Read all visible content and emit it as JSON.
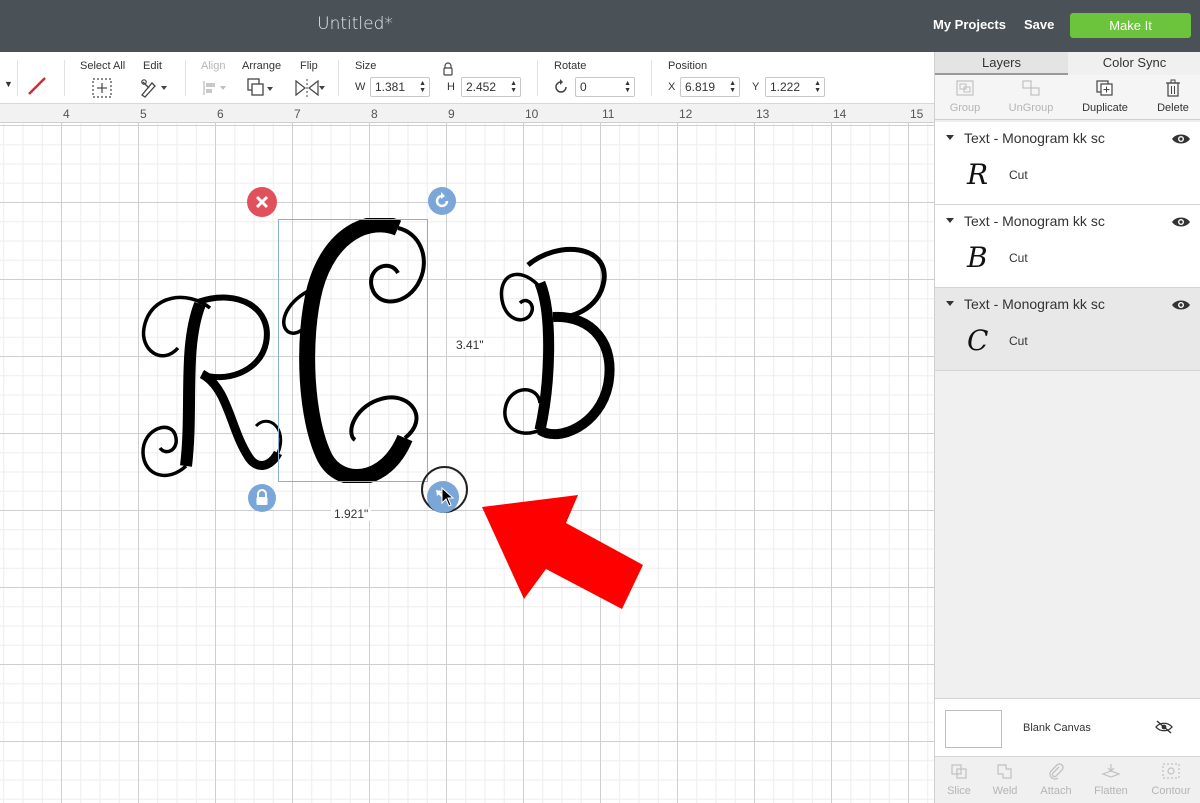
{
  "header": {
    "title": "Untitled*",
    "my_projects": "My Projects",
    "save": "Save",
    "make_it": "Make It",
    "make_it_color": "#6cc33c"
  },
  "toolbar": {
    "select_all": "Select All",
    "edit": "Edit",
    "align": "Align",
    "arrange": "Arrange",
    "flip": "Flip",
    "size": {
      "label": "Size",
      "w_label": "W",
      "w_value": "1.381",
      "h_label": "H",
      "h_value": "2.452"
    },
    "rotate": {
      "label": "Rotate",
      "value": "0"
    },
    "position": {
      "label": "Position",
      "x_label": "X",
      "x_value": "6.819",
      "y_label": "Y",
      "y_value": "1.222"
    }
  },
  "ruler": {
    "ticks": [
      "4",
      "5",
      "6",
      "7",
      "8",
      "9",
      "10",
      "11",
      "12",
      "13",
      "14",
      "15"
    ]
  },
  "canvas": {
    "glyphs": [
      "R",
      "C",
      "B"
    ],
    "height_label": "3.41\"",
    "width_label": "1.921\""
  },
  "panel": {
    "tabs": {
      "layers": "Layers",
      "color_sync": "Color Sync"
    },
    "actions": {
      "group": "Group",
      "ungroup": "UnGroup",
      "duplicate": "Duplicate",
      "delete": "Delete"
    },
    "layers": [
      {
        "title": "Text - Monogram kk sc",
        "glyph": "R",
        "operation": "Cut"
      },
      {
        "title": "Text - Monogram kk sc",
        "glyph": "B",
        "operation": "Cut"
      },
      {
        "title": "Text - Monogram kk sc",
        "glyph": "C",
        "operation": "Cut"
      }
    ],
    "blank_canvas": "Blank Canvas",
    "bottom_actions": {
      "slice": "Slice",
      "weld": "Weld",
      "attach": "Attach",
      "flatten": "Flatten",
      "contour": "Contour"
    }
  },
  "colors": {
    "delete_handle": "#e0515c",
    "handle_blue": "#7aa6d8",
    "arrow": "#ff0000"
  }
}
